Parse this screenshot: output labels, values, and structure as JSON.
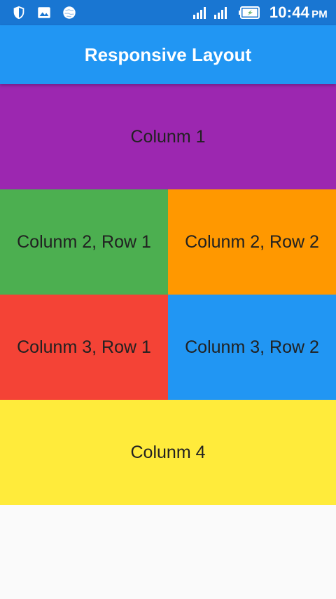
{
  "status_bar": {
    "time": "10:44",
    "ampm": "PM",
    "icons_left": [
      "shield-icon",
      "image-icon",
      "globe-icon"
    ],
    "icons_right": [
      "signal-icon",
      "signal-icon",
      "battery-charging-icon"
    ]
  },
  "app_bar": {
    "title": "Responsive Layout"
  },
  "layout": {
    "column1": "Colunm 1",
    "column2_row1": "Colunm 2, Row 1",
    "column2_row2": "Colunm 2, Row 2",
    "column3_row1": "Colunm 3, Row 1",
    "column3_row2": "Colunm 3, Row 2",
    "column4": "Colunm 4"
  },
  "colors": {
    "status_bar": "#1976d2",
    "app_bar": "#2196f3",
    "column1": "#9c27b0",
    "column2_row1": "#4caf50",
    "column2_row2": "#ff9800",
    "column3_row1": "#f44336",
    "column3_row2": "#2196f3",
    "column4": "#ffeb3b",
    "background": "#fafafa"
  }
}
